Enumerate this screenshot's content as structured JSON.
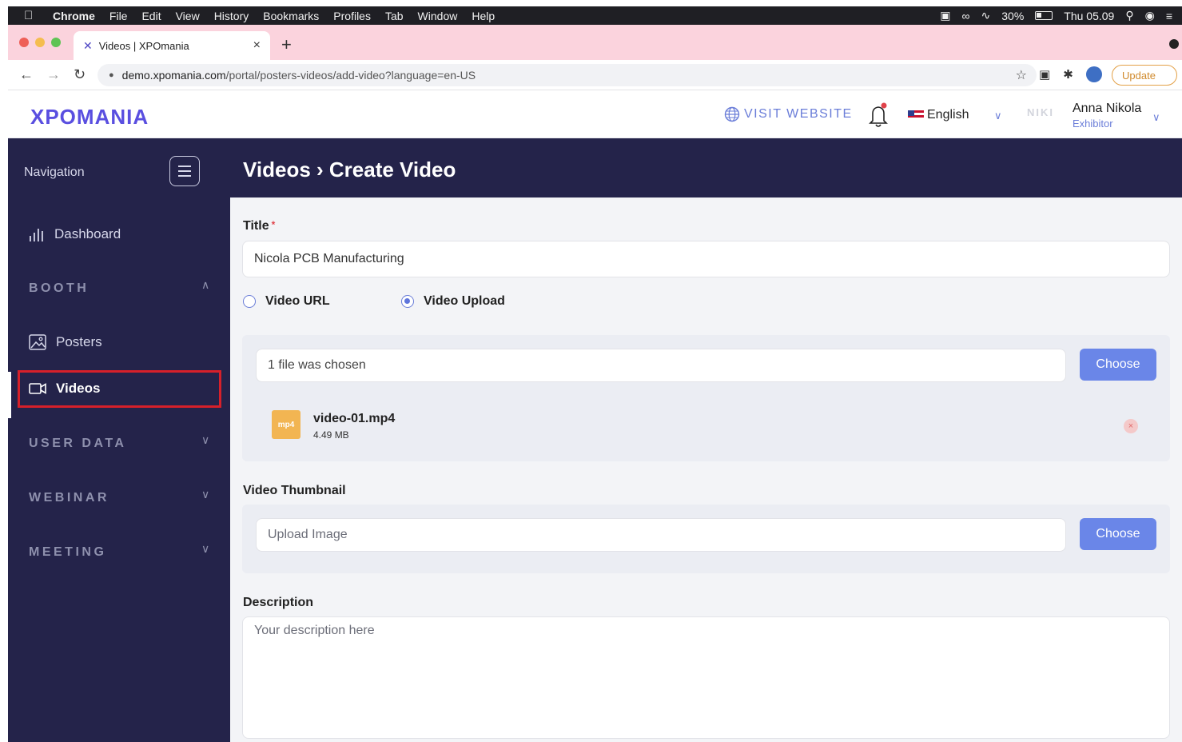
{
  "menubar": {
    "app": "Chrome",
    "items": [
      "File",
      "Edit",
      "View",
      "History",
      "Bookmarks",
      "Profiles",
      "Tab",
      "Window",
      "Help"
    ],
    "battery": "30%",
    "clock": "Thu 05.09"
  },
  "browser": {
    "tab_title": "Videos | XPOmania",
    "url_host": "demo.xpomania.com",
    "url_path": "/portal/posters-videos/add-video?language=en-US",
    "update_label": "Update"
  },
  "header": {
    "logo": "XPOMANIA",
    "visit_label": "VISIT WEBSITE",
    "language": "English",
    "company_placeholder": "NIKI",
    "user_name": "Anna Nikola",
    "user_role": "Exhibitor"
  },
  "sidebar": {
    "title": "Navigation",
    "dashboard": "Dashboard",
    "sec_booth": "BOOTH",
    "posters": "Posters",
    "videos": "Videos",
    "sec_user_data": "USER DATA",
    "sec_webinar": "WEBINAR",
    "sec_meeting": "MEETING"
  },
  "page": {
    "heading": "Videos › Create Video"
  },
  "form": {
    "title_label": "Title",
    "title_required": "*",
    "title_value": "Nicola PCB Manufacturing",
    "opt_url": "Video URL",
    "opt_upload": "Video Upload",
    "selected_option": "Video Upload",
    "file_status": "1 file was chosen",
    "choose_label": "Choose",
    "file_ext": "mp4",
    "file_name": "video-01.mp4",
    "file_size": "4.49 MB",
    "thumb_label": "Video Thumbnail",
    "thumb_placeholder": "Upload Image",
    "desc_label": "Description",
    "desc_placeholder": "Your description here"
  },
  "colors": {
    "sidebar_bg": "#24234a",
    "accent": "#6a86e8",
    "brand": "#5a4fe0",
    "highlight_box": "#d6202a"
  }
}
